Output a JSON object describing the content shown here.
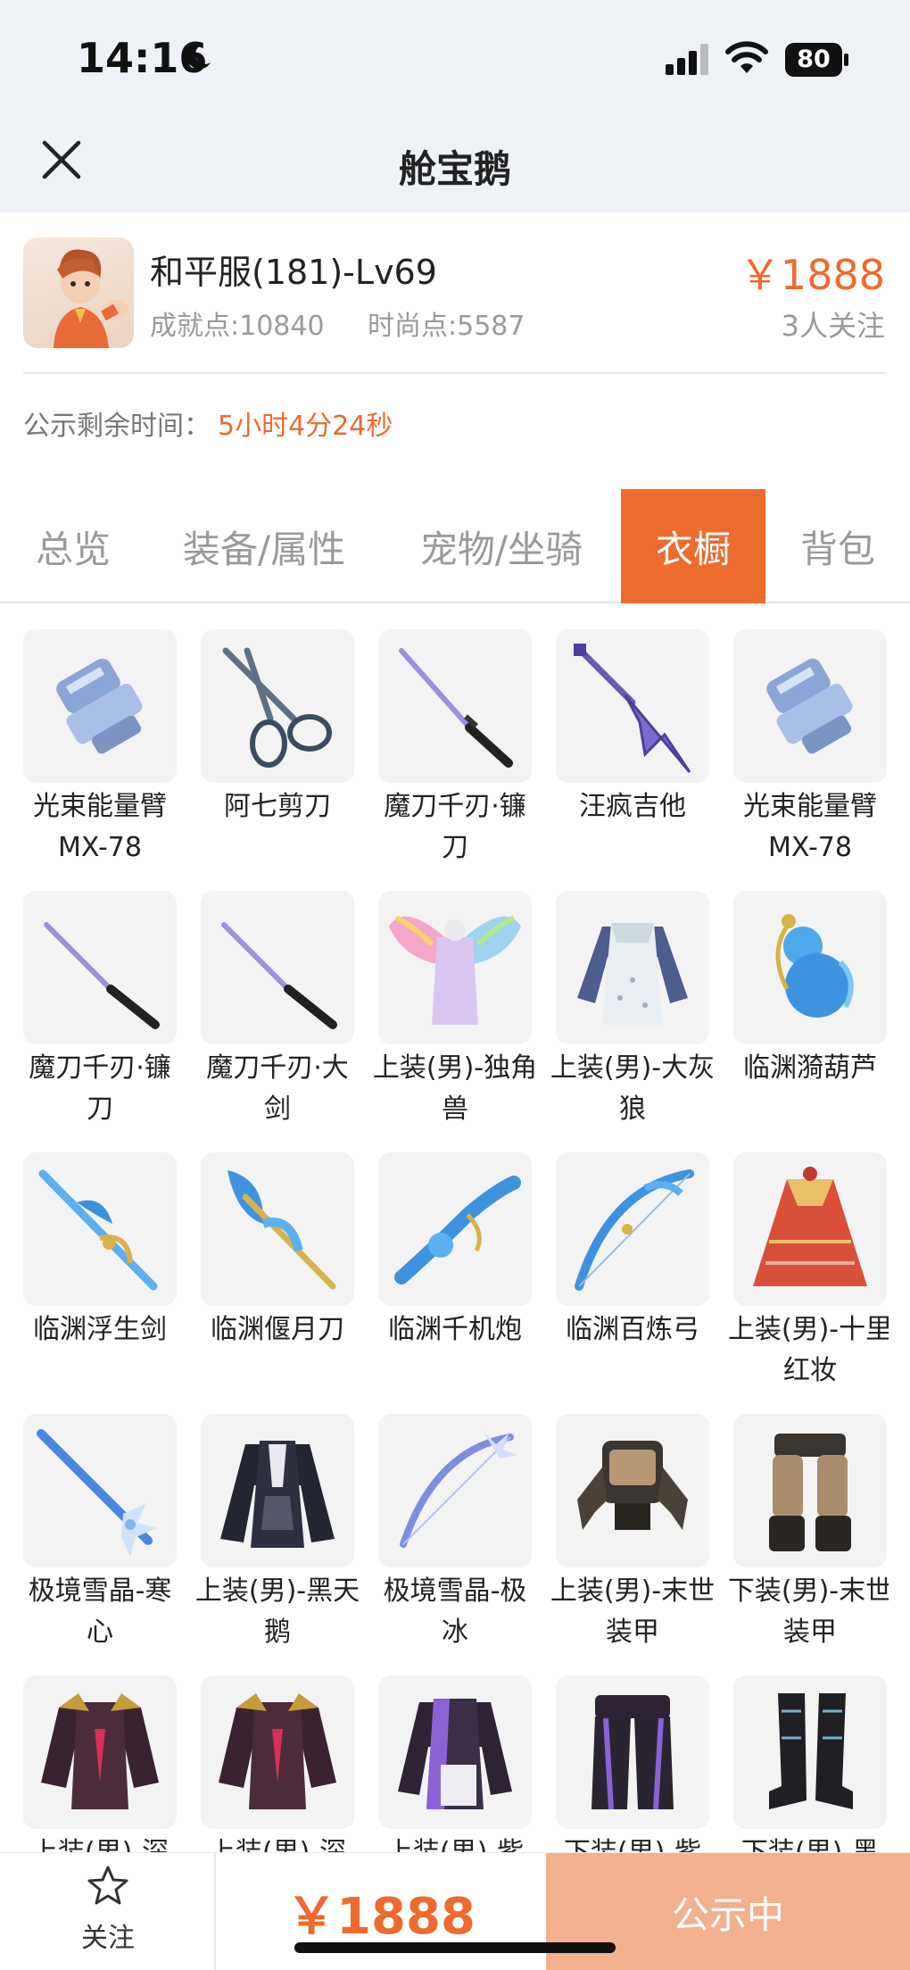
{
  "status_bar": {
    "time": "14:16",
    "battery": "80"
  },
  "nav": {
    "title": "舱宝鹅"
  },
  "character": {
    "name": "和平服(181)-Lv69",
    "achievement": "成就点:10840",
    "fashion": "时尚点:5587",
    "price": "￥1888",
    "followers": "3人关注"
  },
  "countdown": {
    "label": "公示剩余时间：",
    "value": "5小时4分24秒"
  },
  "tabs": [
    {
      "label": "总览"
    },
    {
      "label": "装备/属性"
    },
    {
      "label": "宠物/坐骑"
    },
    {
      "label": "衣橱",
      "active": true
    },
    {
      "label": "背包"
    }
  ],
  "wardrobe": [
    {
      "name": "光束能量臂MX-78",
      "icon": "gauntlet-icon"
    },
    {
      "name": "阿七剪刀",
      "icon": "scissors-icon"
    },
    {
      "name": "魔刀千刃·镰刀",
      "icon": "katana-icon"
    },
    {
      "name": "汪疯吉他",
      "icon": "guitar-icon"
    },
    {
      "name": "光束能量臂MX-78",
      "icon": "gauntlet-icon"
    },
    {
      "name": "魔刀千刃·镰刀",
      "icon": "katana-icon"
    },
    {
      "name": "魔刀千刃·大剑",
      "icon": "katana-icon"
    },
    {
      "name": "上装(男)-独角兽",
      "icon": "winged-outfit-icon"
    },
    {
      "name": "上装(男)-大灰狼",
      "icon": "apron-outfit-icon"
    },
    {
      "name": "临渊漪葫芦",
      "icon": "water-gourd-icon"
    },
    {
      "name": "临渊浮生剑",
      "icon": "water-sword-icon"
    },
    {
      "name": "临渊偃月刀",
      "icon": "water-blade-icon"
    },
    {
      "name": "临渊千机炮",
      "icon": "water-cannon-icon"
    },
    {
      "name": "临渊百炼弓",
      "icon": "water-bow-icon"
    },
    {
      "name": "上装(男)-十里红妆",
      "icon": "red-robe-icon"
    },
    {
      "name": "极境雪晶-寒心",
      "icon": "ice-sword-icon"
    },
    {
      "name": "上装(男)-黑天鹅",
      "icon": "black-coat-icon"
    },
    {
      "name": "极境雪晶-极冰",
      "icon": "ice-bow-icon"
    },
    {
      "name": "上装(男)-末世装甲",
      "icon": "mech-armor-icon"
    },
    {
      "name": "下装(男)-末世装甲",
      "icon": "mech-legs-icon"
    },
    {
      "name": "上装(男)-深",
      "icon": "dark-armor-icon"
    },
    {
      "name": "上装(男)-深",
      "icon": "dark-armor-icon"
    },
    {
      "name": "上装(男)-紫",
      "icon": "purple-jacket-icon"
    },
    {
      "name": "下装(男)-紫",
      "icon": "purple-pants-icon"
    },
    {
      "name": "下装(男)-黑",
      "icon": "black-boots-icon"
    }
  ],
  "bottom_bar": {
    "follow_label": "关注",
    "price": "￥1888",
    "status": "公示中"
  },
  "colors": {
    "accent": "#ee6a2f",
    "accent_light": "#f2b08e",
    "header_bg": "#eef2f7"
  }
}
